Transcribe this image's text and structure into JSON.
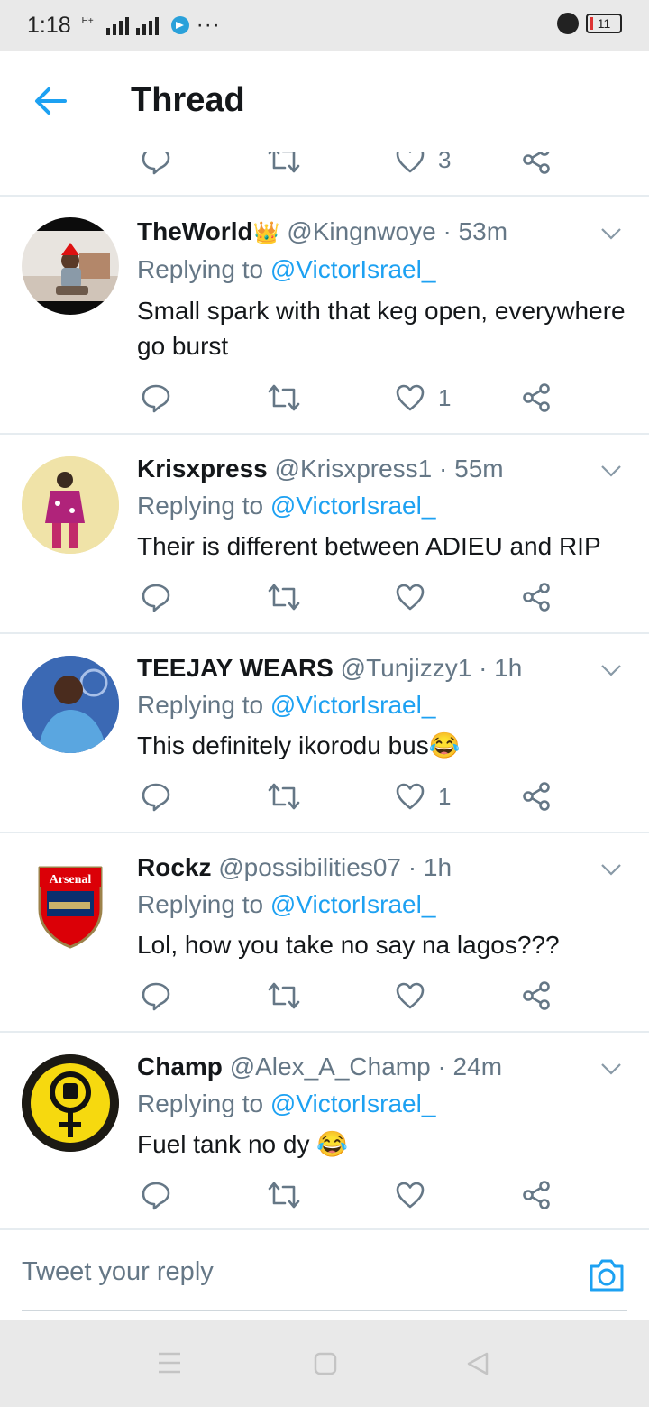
{
  "status_bar": {
    "time": "1:18",
    "network": "H+",
    "overflow": "···",
    "battery": "11",
    "icons": [
      "signal-icon",
      "telegram-icon",
      "alarm-icon",
      "battery-icon"
    ]
  },
  "header": {
    "title": "Thread",
    "back_icon": "back-arrow-icon"
  },
  "previous_tweet_actions": {
    "like_count": "3"
  },
  "tweets": [
    {
      "name": "TheWorld",
      "badge": "👑",
      "handle": "@Kingnwoye",
      "time": "· 53m",
      "replying_prefix": "Replying to",
      "replying_to": "@VictorIsrael_",
      "text": "Small spark with that keg open, everywhere go burst",
      "like_count": "1"
    },
    {
      "name": "Krisxpress",
      "handle": "@Krisxpress1",
      "time": "· 55m",
      "replying_prefix": "Replying to",
      "replying_to": "@VictorIsrael_",
      "text": "Their is different between ADIEU and RIP",
      "like_count": ""
    },
    {
      "name": "TEEJAY WEARS",
      "handle": "@Tunjizzy1",
      "time": "· 1h",
      "replying_prefix": "Replying to",
      "replying_to": "@VictorIsrael_",
      "text": "This definitely ikorodu bus😂",
      "like_count": "1"
    },
    {
      "name": "Rockz",
      "handle": "@possibilities07",
      "time": "· 1h",
      "replying_prefix": "Replying to",
      "replying_to": "@VictorIsrael_",
      "text": "Lol, how you take no say na lagos???",
      "like_count": "",
      "avatar_text": "Arsenal"
    },
    {
      "name": "Champ",
      "handle": "@Alex_A_Champ",
      "time": "· 24m",
      "replying_prefix": "Replying to",
      "replying_to": "@VictorIsrael_",
      "text": "Fuel tank no dy 😂",
      "like_count": ""
    }
  ],
  "reply_bar": {
    "placeholder": "Tweet your reply"
  },
  "colors": {
    "accent": "#1da1f2",
    "text": "#14171a",
    "secondary": "#657786",
    "divider": "#e6ecf0"
  }
}
